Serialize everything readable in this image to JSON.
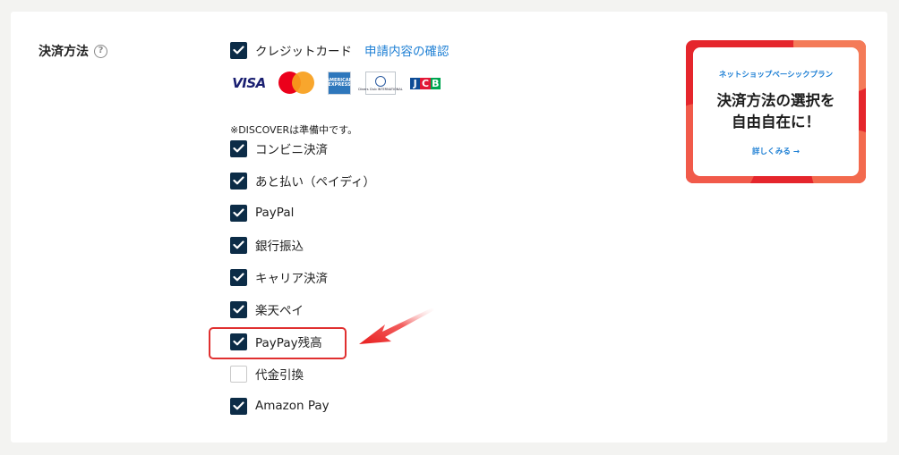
{
  "section": {
    "label": "決済方法",
    "help_glyph": "?"
  },
  "credit_card": {
    "label": "クレジットカード",
    "checked": true,
    "confirm_link": "申請内容の確認"
  },
  "brands": {
    "visa": "VISA",
    "amex": "AMERICAN EXPRESS",
    "diners": "Diners Club INTERNATIONAL",
    "jcb": [
      "J",
      "C",
      "B"
    ]
  },
  "note": "※DISCOVERは準備中です。",
  "payment_options": [
    {
      "label": "コンビニ決済",
      "checked": true
    },
    {
      "label": "あと払い（ペイディ）",
      "checked": true
    },
    {
      "label": "PayPal",
      "checked": true
    },
    {
      "label": "銀行振込",
      "checked": true
    },
    {
      "label": "キャリア決済",
      "checked": true
    },
    {
      "label": "楽天ペイ",
      "checked": true
    },
    {
      "label": "PayPay残高",
      "checked": true,
      "highlighted": true
    },
    {
      "label": "代金引換",
      "checked": false
    },
    {
      "label": "Amazon Pay",
      "checked": true
    }
  ],
  "banner": {
    "subtitle": "ネットショップベーシックプラン",
    "title_line1": "決済方法の選択を",
    "title_line2": "自由自在に！",
    "link": "詳しくみる →"
  },
  "colors": {
    "checkbox": "#0c2c47",
    "link": "#1d7fd4",
    "highlight": "#e03030",
    "banner_red": "#e5262c"
  }
}
